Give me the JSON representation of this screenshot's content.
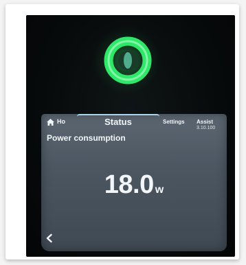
{
  "header": {
    "home_label": "Ho",
    "tabs": [
      {
        "label": "Status"
      },
      {
        "label": "Settings"
      },
      {
        "label": "Assist"
      }
    ],
    "version": "3.10.100"
  },
  "main": {
    "title": "Power consumption",
    "value": "18.0",
    "unit": "w"
  },
  "icons": {
    "status_ring": "ring-icon",
    "home": "home-icon",
    "back": "back-icon"
  },
  "colors": {
    "ring": "#2fe86a",
    "screen": "#4e5964",
    "tab_accent": "#a8d6ec"
  }
}
